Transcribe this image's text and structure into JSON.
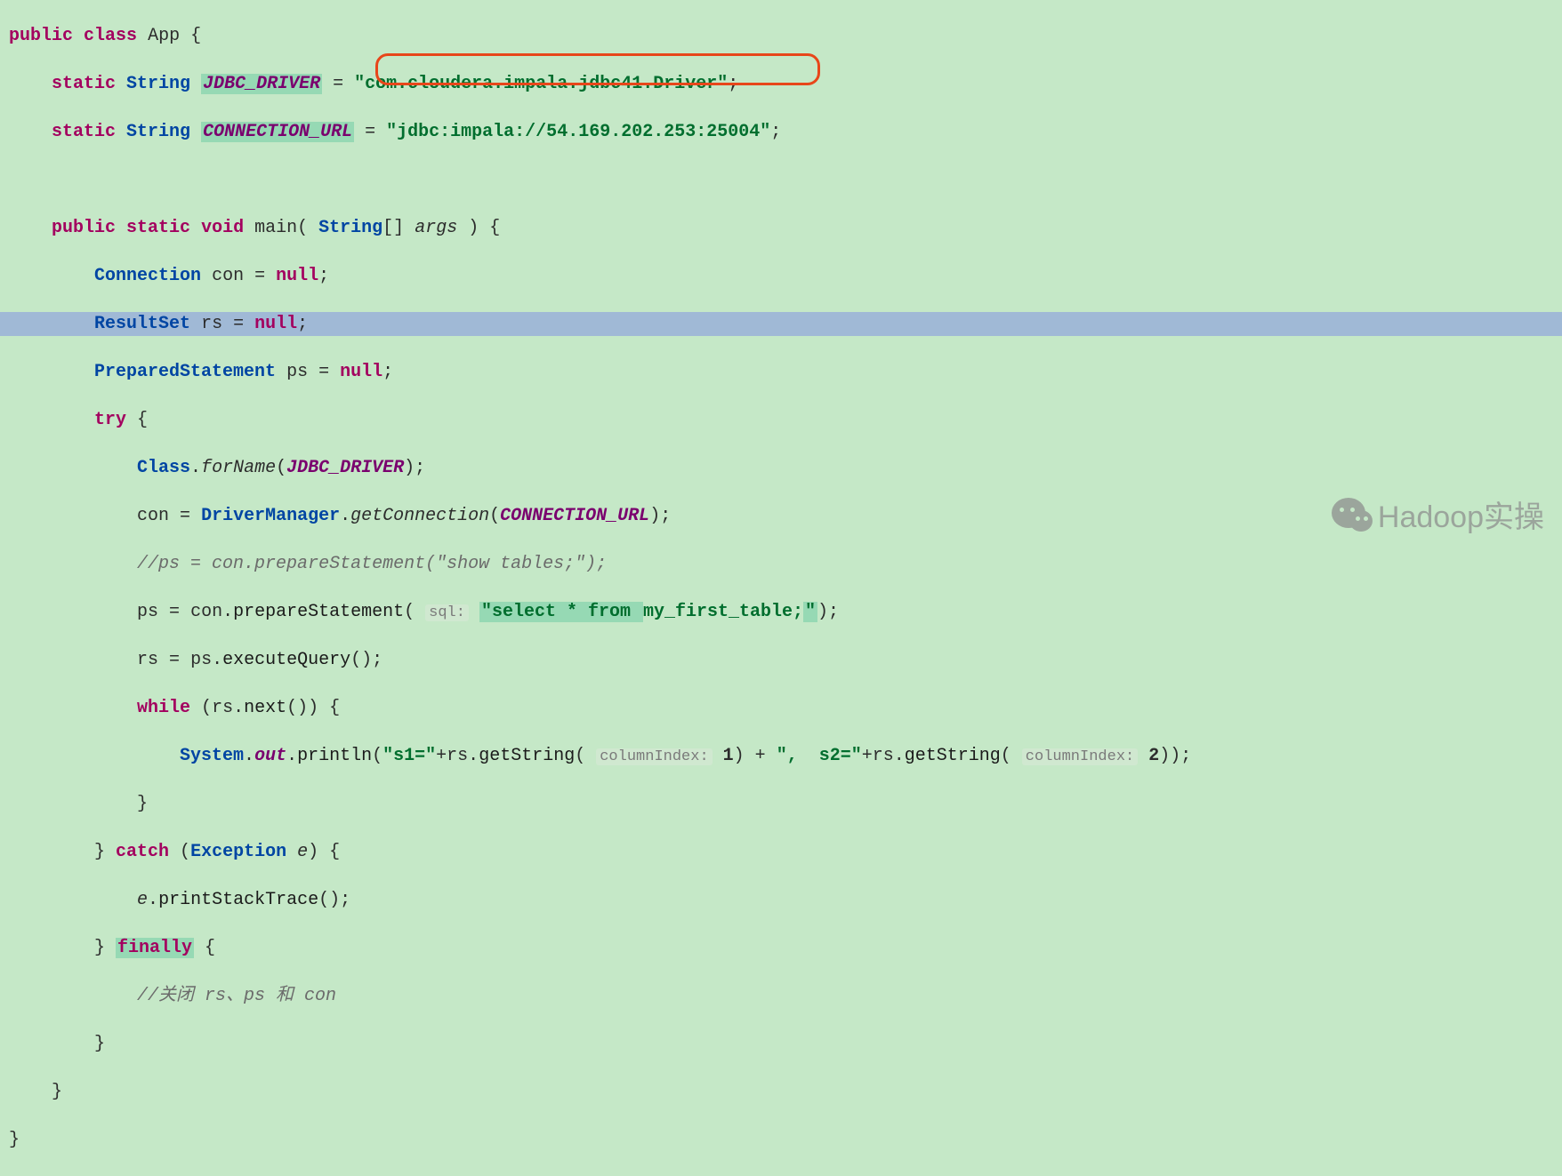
{
  "code": {
    "line1": {
      "kw_public": "public",
      "kw_class": "class",
      "classname": "App",
      "brace": "{"
    },
    "line2": {
      "kw_static": "static",
      "type": "String",
      "field": "JDBC_DRIVER",
      "eq": "=",
      "value": "\"com.cloudera.impala.jdbc41.Driver\"",
      "semi": ";"
    },
    "line3": {
      "kw_static": "static",
      "type": "String",
      "field": "CONNECTION_URL",
      "eq": "=",
      "value": "\"jdbc:impala://54.169.202.253:25004\"",
      "semi": ";"
    },
    "line5": {
      "kw_public": "public",
      "kw_static": "static",
      "kw_void": "void",
      "method": "main",
      "lparen": "( ",
      "type": "String",
      "brackets": "[]",
      "param": "args",
      "rparen": " ) {"
    },
    "line6": {
      "type": "Connection",
      "var": "con",
      "eq": " = ",
      "null": "null",
      "semi": ";"
    },
    "line7": {
      "type": "ResultSet",
      "var": "rs",
      "eq": " = ",
      "null": "null",
      "semi": ";"
    },
    "line8": {
      "type": "PreparedStatement",
      "var": "ps",
      "eq": " = ",
      "null": "null",
      "semi": ";"
    },
    "line9": {
      "kw_try": "try",
      "brace": " {"
    },
    "line10": {
      "classname": "Class",
      "dot": ".",
      "method": "forName",
      "lparen": "(",
      "arg": "JDBC_DRIVER",
      "rparen": ");"
    },
    "line11": {
      "var": "con",
      "eq": " = ",
      "classname": "DriverManager",
      "dot": ".",
      "method": "getConnection",
      "lparen": "(",
      "arg": "CONNECTION_URL",
      "rparen": ");"
    },
    "line12": {
      "comment": "//ps = con.prepareStatement(\"show tables;\");"
    },
    "line13": {
      "var": "ps",
      "eq": " = ",
      "obj": "con",
      "dot": ".",
      "method": "prepareStatement",
      "lparen": "( ",
      "hint": "sql:",
      "str_prefix": "\"select * from ",
      "str_hl": "my_first_table;",
      "str_suffix": "\"",
      "rparen": ");"
    },
    "line14": {
      "var": "rs",
      "eq": " = ",
      "obj": "ps",
      "dot": ".",
      "method": "executeQuery",
      "parens": "();"
    },
    "line15": {
      "kw_while": "while",
      "lparen": " (",
      "obj": "rs",
      "dot": ".",
      "method": "next",
      "rparen": "()) {"
    },
    "line16": {
      "classname": "System",
      "dot1": ".",
      "out": "out",
      "dot2": ".",
      "method": "println",
      "lparen": "(",
      "str1": "\"s1=\"",
      "plus1": "+",
      "obj1": "rs",
      "dot3": ".",
      "method2": "getString",
      "lparen2": "( ",
      "hint1": "columnIndex:",
      "num1": " 1",
      "rparen1": ") + ",
      "str2": "\",  s2=\"",
      "plus2": "+",
      "obj2": "rs",
      "dot4": ".",
      "method3": "getString",
      "lparen3": "( ",
      "hint2": "columnIndex:",
      "num2": " 2",
      "rparen3": "));"
    },
    "line17": {
      "brace": "}"
    },
    "line18": {
      "brace": "} ",
      "kw_catch": "catch",
      "lparen": " (",
      "type": "Exception",
      "var": " e",
      "rparen": ") {"
    },
    "line19": {
      "obj": "e",
      "dot": ".",
      "method": "printStackTrace",
      "parens": "();"
    },
    "line20": {
      "brace": "} ",
      "kw_finally": "finally",
      "brace2": " {"
    },
    "line21": {
      "comment": "//关闭 rs、ps 和 con"
    },
    "line22": {
      "brace": "}"
    },
    "line23": {
      "brace": "}"
    },
    "line24": {
      "brace": "}"
    }
  },
  "watermark": {
    "text": "Hadoop实操"
  }
}
